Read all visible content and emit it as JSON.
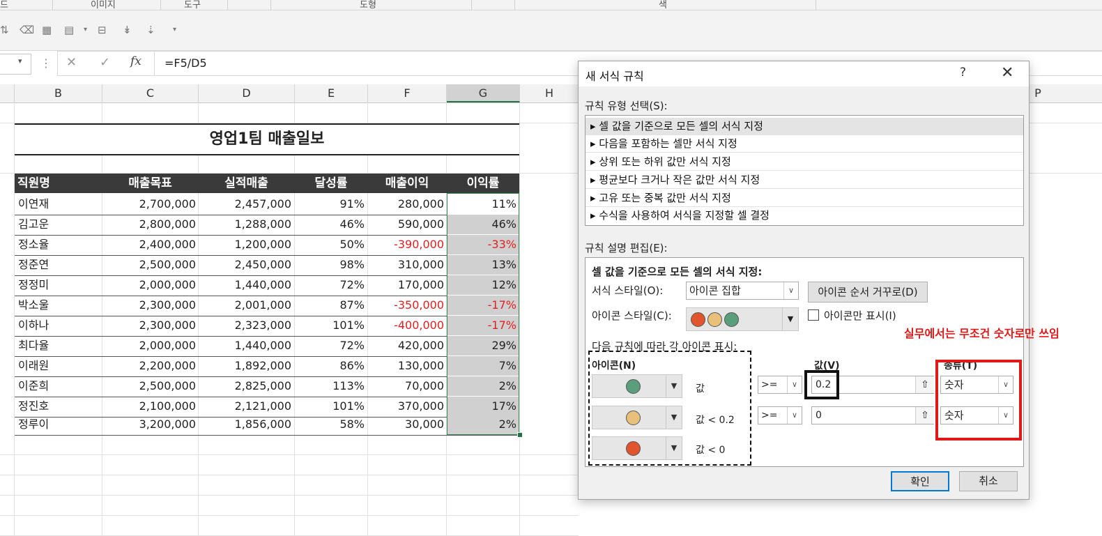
{
  "ribbon": {
    "groups": [
      "드",
      "이미지",
      "도구",
      "도형",
      "색"
    ]
  },
  "formula_bar": {
    "cancel_icon": "✕",
    "enter_icon": "✓",
    "fx_icon": "fx",
    "formula": "=F5/D5"
  },
  "columns": [
    "B",
    "C",
    "D",
    "E",
    "F",
    "G",
    "H",
    "P"
  ],
  "sheet": {
    "title": "영업1팀 매출일보",
    "headers": [
      "직원명",
      "매출목표",
      "실적매출",
      "달성률",
      "매출이익",
      "이익률"
    ],
    "rows": [
      [
        "이연재",
        "2,700,000",
        "2,457,000",
        "91%",
        "280,000",
        "11%"
      ],
      [
        "김고운",
        "2,800,000",
        "1,288,000",
        "46%",
        "590,000",
        "46%"
      ],
      [
        "정소율",
        "2,400,000",
        "1,200,000",
        "50%",
        "-390,000",
        "-33%"
      ],
      [
        "정준연",
        "2,500,000",
        "2,450,000",
        "98%",
        "310,000",
        "13%"
      ],
      [
        "정정미",
        "2,000,000",
        "1,440,000",
        "72%",
        "170,000",
        "12%"
      ],
      [
        "박소울",
        "2,300,000",
        "2,001,000",
        "87%",
        "-350,000",
        "-17%"
      ],
      [
        "이하나",
        "2,300,000",
        "2,323,000",
        "101%",
        "-400,000",
        "-17%"
      ],
      [
        "최다율",
        "2,000,000",
        "1,440,000",
        "72%",
        "420,000",
        "29%"
      ],
      [
        "이래원",
        "2,200,000",
        "1,892,000",
        "86%",
        "130,000",
        "7%"
      ],
      [
        "이준희",
        "2,500,000",
        "2,825,000",
        "113%",
        "70,000",
        "2%"
      ],
      [
        "정진호",
        "2,100,000",
        "2,121,000",
        "101%",
        "370,000",
        "17%"
      ],
      [
        "정루이",
        "3,200,000",
        "1,856,000",
        "58%",
        "30,000",
        "2%"
      ]
    ],
    "negative_color": "#e02020"
  },
  "dialog": {
    "title": "새 서식 규칙",
    "help": "?",
    "close": "✕",
    "rule_type_label": "규칙 유형 선택(S):",
    "rule_types": [
      "▸ 셀 값을 기준으로 모든 셀의 서식 지정",
      "▸ 다음을 포함하는 셀만 서식 지정",
      "▸ 상위 또는 하위 값만 서식 지정",
      "▸ 평균보다 크거나 작은 값만 서식 지정",
      "▸ 고유 또는 중복 값만 서식 지정",
      "▸ 수식을 사용하여 서식을 지정할 셀 결정"
    ],
    "desc_label": "규칙 설명 편집(E):",
    "desc_heading": "셀 값을 기준으로 모든 셀의 서식 지정:",
    "format_style_label": "서식 스타일(O):",
    "format_style_value": "아이콘 집합",
    "reverse_button": "아이콘 순서 거꾸로(D)",
    "icon_style_label": "아이콘 스타일(C):",
    "icon_only_label": "아이콘만 표시(I)",
    "rules_caption": "다음 규칙에 따라 각 아이콘 표시:",
    "col_icon": "아이콘(N)",
    "col_value": "값(V)",
    "col_type": "종류(T)",
    "icon_rows": [
      {
        "icon": "green-circle",
        "condition": "값",
        "operator": ">=",
        "value": "0.2",
        "type": "숫자"
      },
      {
        "icon": "yellow-circle",
        "condition": "값 < 0.2",
        "operator": ">=",
        "value": "0",
        "type": "숫자"
      },
      {
        "icon": "red-circle",
        "condition": "값 < 0",
        "operator": "",
        "value": "",
        "type": ""
      }
    ],
    "ok": "확인",
    "cancel": "취소",
    "colors": {
      "green": "#5a9e7c",
      "yellow": "#e8c07a",
      "red": "#e0552e"
    }
  },
  "annotation": "실무에서는 무조건 숫자로만 쓰임",
  "annotation_color": "#e01818"
}
